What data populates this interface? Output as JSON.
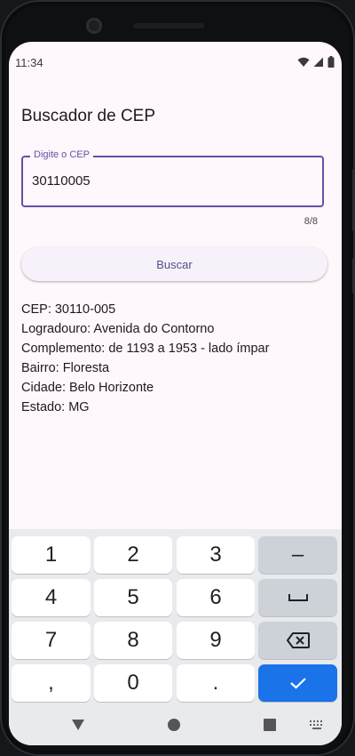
{
  "status_bar": {
    "time": "11:34"
  },
  "app": {
    "title": "Buscador de CEP",
    "cep_field": {
      "label": "Digite o CEP",
      "value": "30110005",
      "counter": "8/8"
    },
    "search_button_label": "Buscar",
    "result": {
      "cep": "CEP: 30110-005",
      "logradouro": "Logradouro: Avenida do Contorno",
      "complemento": "Complemento: de 1193 a 1953 - lado ímpar",
      "bairro": "Bairro: Floresta",
      "cidade": "Cidade: Belo Horizonte",
      "estado": "Estado: MG"
    }
  },
  "keyboard": {
    "keys": [
      "1",
      "2",
      "3",
      "–",
      "4",
      "5",
      "6",
      "7",
      "8",
      "9",
      ",",
      "0",
      "."
    ],
    "icons": {
      "space": "space-bar-icon",
      "backspace": "backspace-icon",
      "enter": "check-icon"
    },
    "accent_color": "#1a73e8"
  },
  "navigation_bar": {
    "icons": [
      "back-triangle-icon",
      "home-circle-icon",
      "recents-square-icon",
      "keyboard-switch-icon"
    ]
  }
}
